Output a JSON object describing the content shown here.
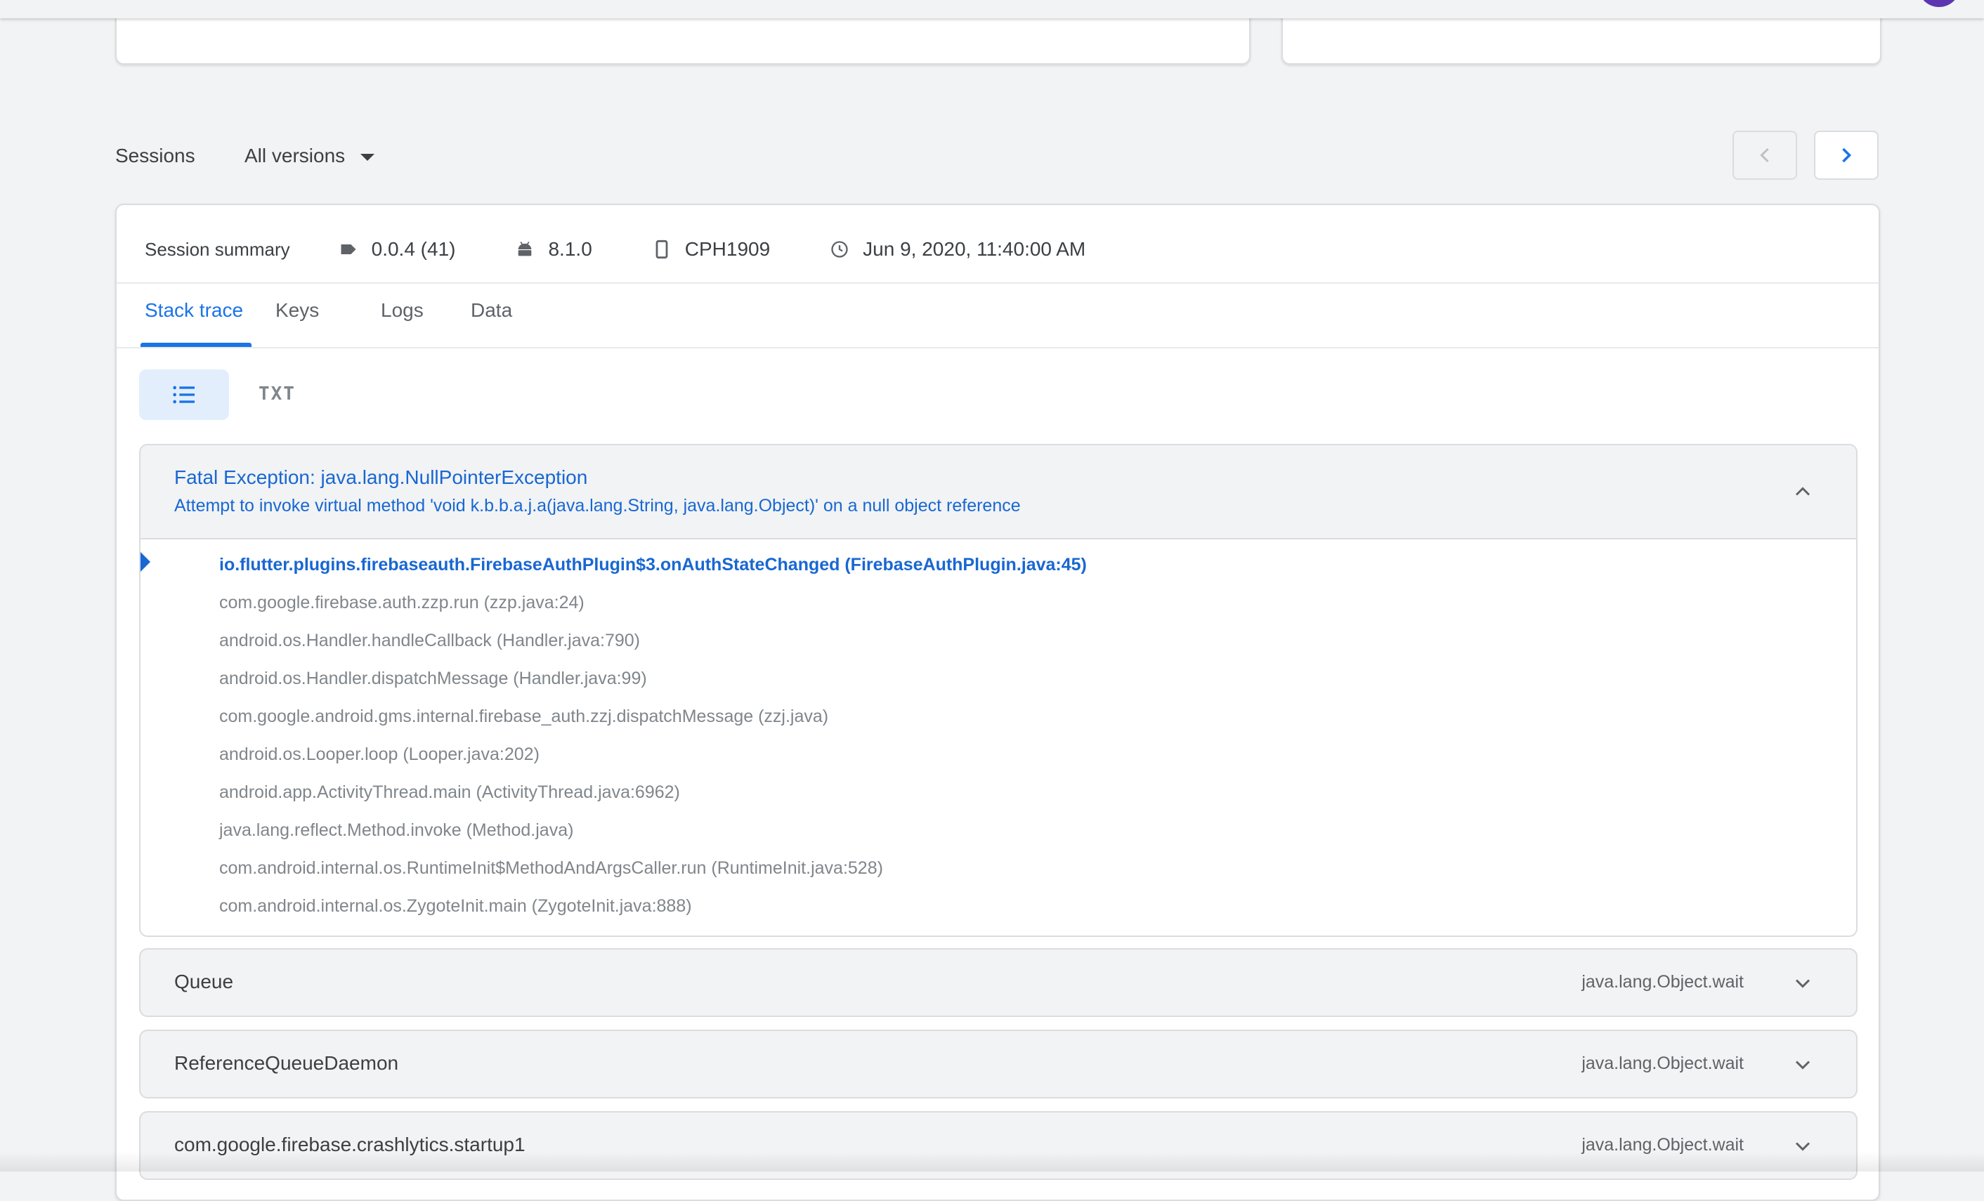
{
  "sessions": {
    "label": "Sessions",
    "version_filter": "All versions"
  },
  "session": {
    "summary_title": "Session summary",
    "app_version": "0.0.4 (41)",
    "os_version": "8.1.0",
    "device": "CPH1909",
    "timestamp": "Jun 9, 2020, 11:40:00 AM",
    "icons": {
      "app_version": "label-tag-icon",
      "os_version": "android-icon",
      "device": "phone-icon",
      "timestamp": "clock-icon"
    }
  },
  "tabs": [
    {
      "label": "Stack trace",
      "active": true
    },
    {
      "label": "Keys",
      "active": false
    },
    {
      "label": "Logs",
      "active": false
    },
    {
      "label": "Data",
      "active": false
    }
  ],
  "view_toggle": {
    "list_icon": "list-icon",
    "txt_label": "TXT"
  },
  "fatal": {
    "title": "Fatal Exception: java.lang.NullPointerException",
    "message": "Attempt to invoke virtual method 'void k.b.b.a.j.a(java.lang.String, java.lang.Object)' on a null object reference",
    "frames": [
      "io.flutter.plugins.firebaseauth.FirebaseAuthPlugin$3.onAuthStateChanged (FirebaseAuthPlugin.java:45)",
      "com.google.firebase.auth.zzp.run (zzp.java:24)",
      "android.os.Handler.handleCallback (Handler.java:790)",
      "android.os.Handler.dispatchMessage (Handler.java:99)",
      "com.google.android.gms.internal.firebase_auth.zzj.dispatchMessage (zzj.java)",
      "android.os.Looper.loop (Looper.java:202)",
      "android.app.ActivityThread.main (ActivityThread.java:6962)",
      "java.lang.reflect.Method.invoke (Method.java)",
      "com.android.internal.os.RuntimeInit$MethodAndArgsCaller.run (RuntimeInit.java:528)",
      "com.android.internal.os.ZygoteInit.main (ZygoteInit.java:888)"
    ]
  },
  "threads": [
    {
      "name": "Queue",
      "frame": "java.lang.Object.wait"
    },
    {
      "name": "ReferenceQueueDaemon",
      "frame": "java.lang.Object.wait"
    },
    {
      "name": "com.google.firebase.crashlytics.startup1",
      "frame": "java.lang.Object.wait"
    }
  ],
  "colors": {
    "accent": "#1a73e8",
    "link_text": "#1967d2",
    "avatar": "#5e35b1",
    "background": "#f1f3f4"
  }
}
